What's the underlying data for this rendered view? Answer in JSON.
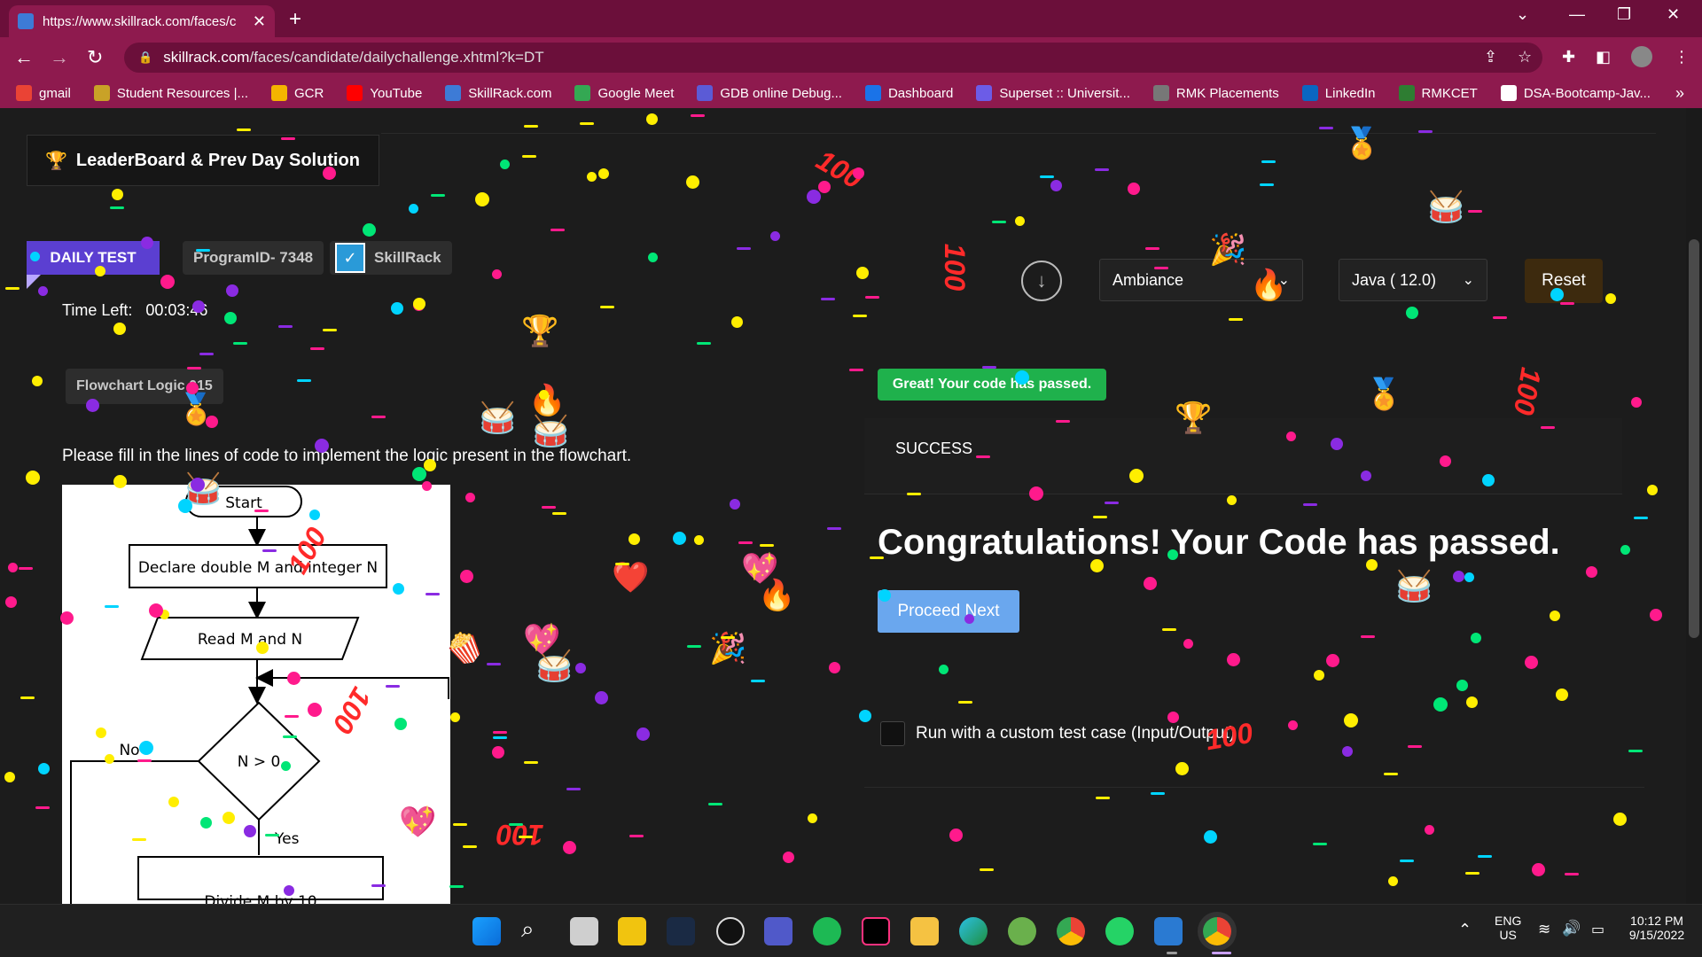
{
  "browser": {
    "tab_title": "https://www.skillrack.com/faces/c",
    "url_host": "skillrack.com",
    "url_path": "/faces/candidate/dailychallenge.xhtml?k=DT",
    "bookmarks": [
      {
        "label": "gmail",
        "color": "#ea4335"
      },
      {
        "label": "Student Resources |...",
        "color": "#c9a227"
      },
      {
        "label": "GCR",
        "color": "#f4b400"
      },
      {
        "label": "YouTube",
        "color": "#ff0000"
      },
      {
        "label": "SkillRack.com",
        "color": "#3d7bd6"
      },
      {
        "label": "Google Meet",
        "color": "#34a853"
      },
      {
        "label": "GDB online Debug...",
        "color": "#5b5bd6"
      },
      {
        "label": "Dashboard",
        "color": "#1a73e8"
      },
      {
        "label": "Superset :: Universit...",
        "color": "#6c5ce7"
      },
      {
        "label": "RMK Placements",
        "color": "#777777"
      },
      {
        "label": "LinkedIn",
        "color": "#0a66c2"
      },
      {
        "label": "RMKCET",
        "color": "#2e7d32"
      },
      {
        "label": "DSA-Bootcamp-Jav...",
        "color": "#ffffff"
      }
    ]
  },
  "page": {
    "leaderboard_label": "LeaderBoard & Prev Day Solution",
    "daily_test_label": "DAILY TEST",
    "program_id": "ProgramID- 7348",
    "skillrack_label": "SkillRack",
    "time_left_label": "Time Left:",
    "time_left_value": "00:03:46",
    "flowchart_tag": "Flowchart Logic 015",
    "instruction": "Please fill in the lines of code to implement the logic present in the flowchart.",
    "flow": {
      "start": "Start",
      "declare": "Declare double M and integer N",
      "read": "Read M and N",
      "condition": "N > 0",
      "no": "No",
      "yes": "Yes",
      "next": "Divide M by 10"
    },
    "theme_select": "Ambiance",
    "language_select": "Java ( 12.0)",
    "reset_label": "Reset",
    "pass_badge": "Great! Your code has passed.",
    "result_text": "SUCCESS",
    "congrats": "Congratulations! Your Code has passed.",
    "proceed_label": "Proceed Next",
    "custom_test_label": "Run with a custom test case (Input/Output)"
  },
  "taskbar": {
    "lang_top": "ENG",
    "lang_bottom": "US",
    "time": "10:12 PM",
    "date": "9/15/2022"
  },
  "colors": {
    "daily_badge": "#5b3fd1",
    "pass_green": "#1fb14c",
    "proceed_blue": "#6aa7ee",
    "tab_bar": "#6b0f3a"
  }
}
